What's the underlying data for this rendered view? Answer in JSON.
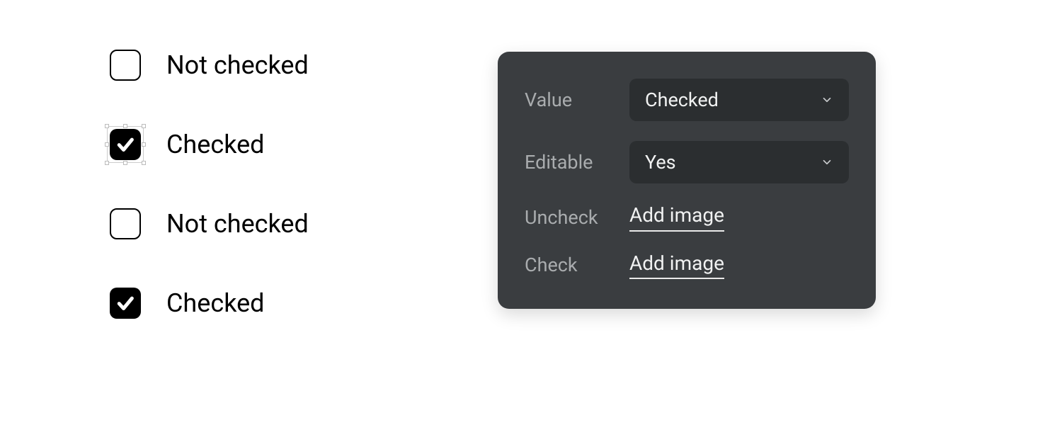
{
  "checkboxes": [
    {
      "label": "Not checked",
      "checked": false,
      "selected": false
    },
    {
      "label": "Checked",
      "checked": true,
      "selected": true
    },
    {
      "label": "Not checked",
      "checked": false,
      "selected": false
    },
    {
      "label": "Checked",
      "checked": true,
      "selected": false
    }
  ],
  "panel": {
    "rows": {
      "value": {
        "label": "Value",
        "value": "Checked"
      },
      "editable": {
        "label": "Editable",
        "value": "Yes"
      },
      "uncheck": {
        "label": "Uncheck",
        "action": "Add image"
      },
      "check": {
        "label": "Check",
        "action": "Add image"
      }
    }
  }
}
